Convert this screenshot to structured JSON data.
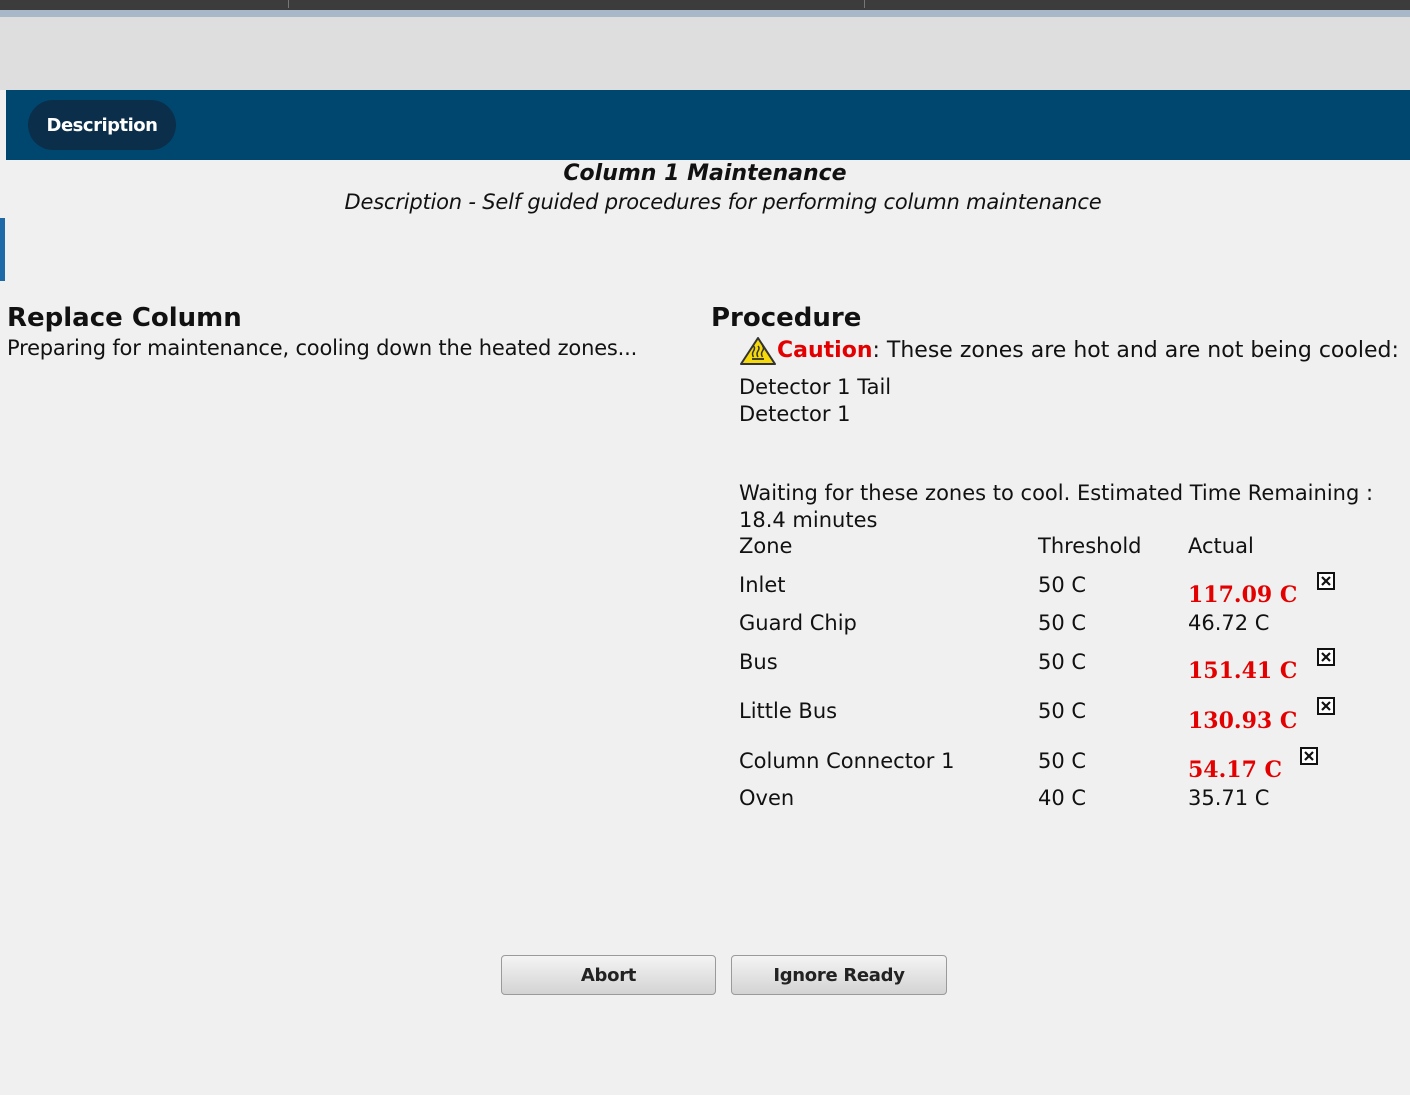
{
  "nav": {
    "tab_label": "Description"
  },
  "header": {
    "title": "Column 1 Maintenance",
    "subtitle": "Description - Self guided procedures for performing column maintenance"
  },
  "left": {
    "heading": "Replace Column",
    "status": "Preparing for maintenance, cooling down the heated zones..."
  },
  "procedure": {
    "heading": "Procedure",
    "caution_word": "Caution",
    "caution_text": ": These zones are hot and are not being cooled:",
    "uncooled_zones": [
      "Detector 1 Tail",
      "Detector 1"
    ],
    "waiting_text": "Waiting for these zones to cool. Estimated Time Remaining :",
    "time_remaining": "18.4 minutes",
    "columns": {
      "zone": "Zone",
      "threshold": "Threshold",
      "actual": "Actual"
    },
    "rows": [
      {
        "zone": "Inlet",
        "threshold": "50 C",
        "actual": "117.09 C",
        "hot": true
      },
      {
        "zone": "Guard Chip",
        "threshold": "50 C",
        "actual": "46.72 C",
        "hot": false
      },
      {
        "zone": "Bus",
        "threshold": "50 C",
        "actual": "151.41 C",
        "hot": true
      },
      {
        "zone": "Little Bus",
        "threshold": "50 C",
        "actual": "130.93 C",
        "hot": true
      },
      {
        "zone": "Column Connector 1",
        "threshold": "50 C",
        "actual": "54.17 C",
        "hot": true
      },
      {
        "zone": "Oven",
        "threshold": "40 C",
        "actual": "35.71 C",
        "hot": false
      }
    ]
  },
  "buttons": {
    "abort": "Abort",
    "ignore_ready": "Ignore Ready"
  },
  "colors": {
    "navbar": "#00476f",
    "tab": "#0b2e4a",
    "hot_text": "#e30000",
    "background": "#f0f0f0"
  }
}
